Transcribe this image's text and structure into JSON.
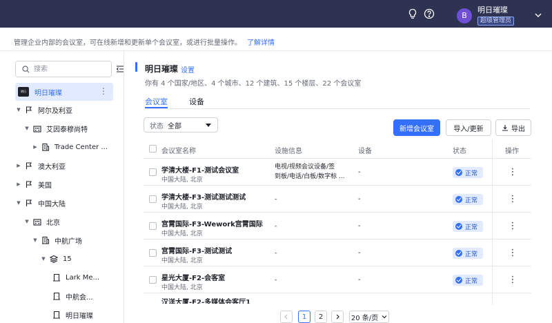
{
  "header": {
    "user_initial": "B",
    "user_name": "明日璀璨",
    "user_role": "超级管理员",
    "icons": [
      "lightbulb-icon",
      "help-icon",
      "chevron-down-icon"
    ]
  },
  "infobar": {
    "text": "管理企业内部的会议室，可在线新增和更新单个会议室，或进行批量操作。",
    "link": "了解详情"
  },
  "sidebar": {
    "search_placeholder": "搜索",
    "root": "明日璀璨",
    "root_logo_text": "明日",
    "items": [
      {
        "label": "阿尔及利亚",
        "icon": "flag-icon"
      },
      {
        "label": "艾因泰穆尚特",
        "icon": "building-icon"
      },
      {
        "label": "Trade Center ...",
        "icon": "office-icon"
      },
      {
        "label": "澳大利亚",
        "icon": "flag-icon"
      },
      {
        "label": "美国",
        "icon": "flag-icon"
      },
      {
        "label": "中国大陆",
        "icon": "flag-icon"
      },
      {
        "label": "北京",
        "icon": "building-icon"
      },
      {
        "label": "中航广场",
        "icon": "office-icon"
      },
      {
        "label": "15",
        "icon": "layers-icon"
      },
      {
        "label": "Lark Me...",
        "icon": "room-icon"
      },
      {
        "label": "中航会...",
        "icon": "room-icon"
      },
      {
        "label": "明日璀璨",
        "icon": "room-icon"
      }
    ]
  },
  "main": {
    "title": "明日璀璨",
    "title_link": "设置",
    "summary": "你有 4 个国家/地区、4 个城市、12 个建筑、15 个楼层、22 个会议室",
    "tabs": [
      "会议室",
      "设备"
    ],
    "filter_label": "状态",
    "filter_value": "全部",
    "buttons": {
      "add": "新增会议室",
      "import_update": "导入/更新",
      "export": "导出"
    },
    "columns": [
      "会议室名称",
      "设施信息",
      "设备",
      "状态",
      "操作"
    ],
    "rows": [
      {
        "name": "学清大楼-F1-测试会议室",
        "location": "中国大陆, 北京",
        "facility": [
          "电视/视频会议设备/签",
          "到板/电话/白板/数字标 ..."
        ],
        "equipment": "-",
        "status": "正常"
      },
      {
        "name": "学清大楼-F3-测试测试测试",
        "location": "中国大陆, 北京",
        "facility": [
          "-"
        ],
        "equipment": "-",
        "status": "正常"
      },
      {
        "name": "宫霄国际-F3-Wework宫霄国际",
        "location": "中国大陆, 北京",
        "facility": [
          "-"
        ],
        "equipment": "-",
        "status": "正常"
      },
      {
        "name": "宫霄国际-F3-测试测试",
        "location": "中国大陆, 北京",
        "facility": [
          "-"
        ],
        "equipment": "-",
        "status": "正常"
      },
      {
        "name": "星光大厦-F2-会客室",
        "location": "中国大陆, 北京",
        "facility": [
          "-"
        ],
        "equipment": "-",
        "status": "正常"
      }
    ],
    "partial_row_name": "汉洋大厦-F2-多媒体会客厅1",
    "pagination": {
      "pages": [
        "1",
        "2"
      ],
      "current": "1",
      "page_size": "20 条/页"
    }
  }
}
